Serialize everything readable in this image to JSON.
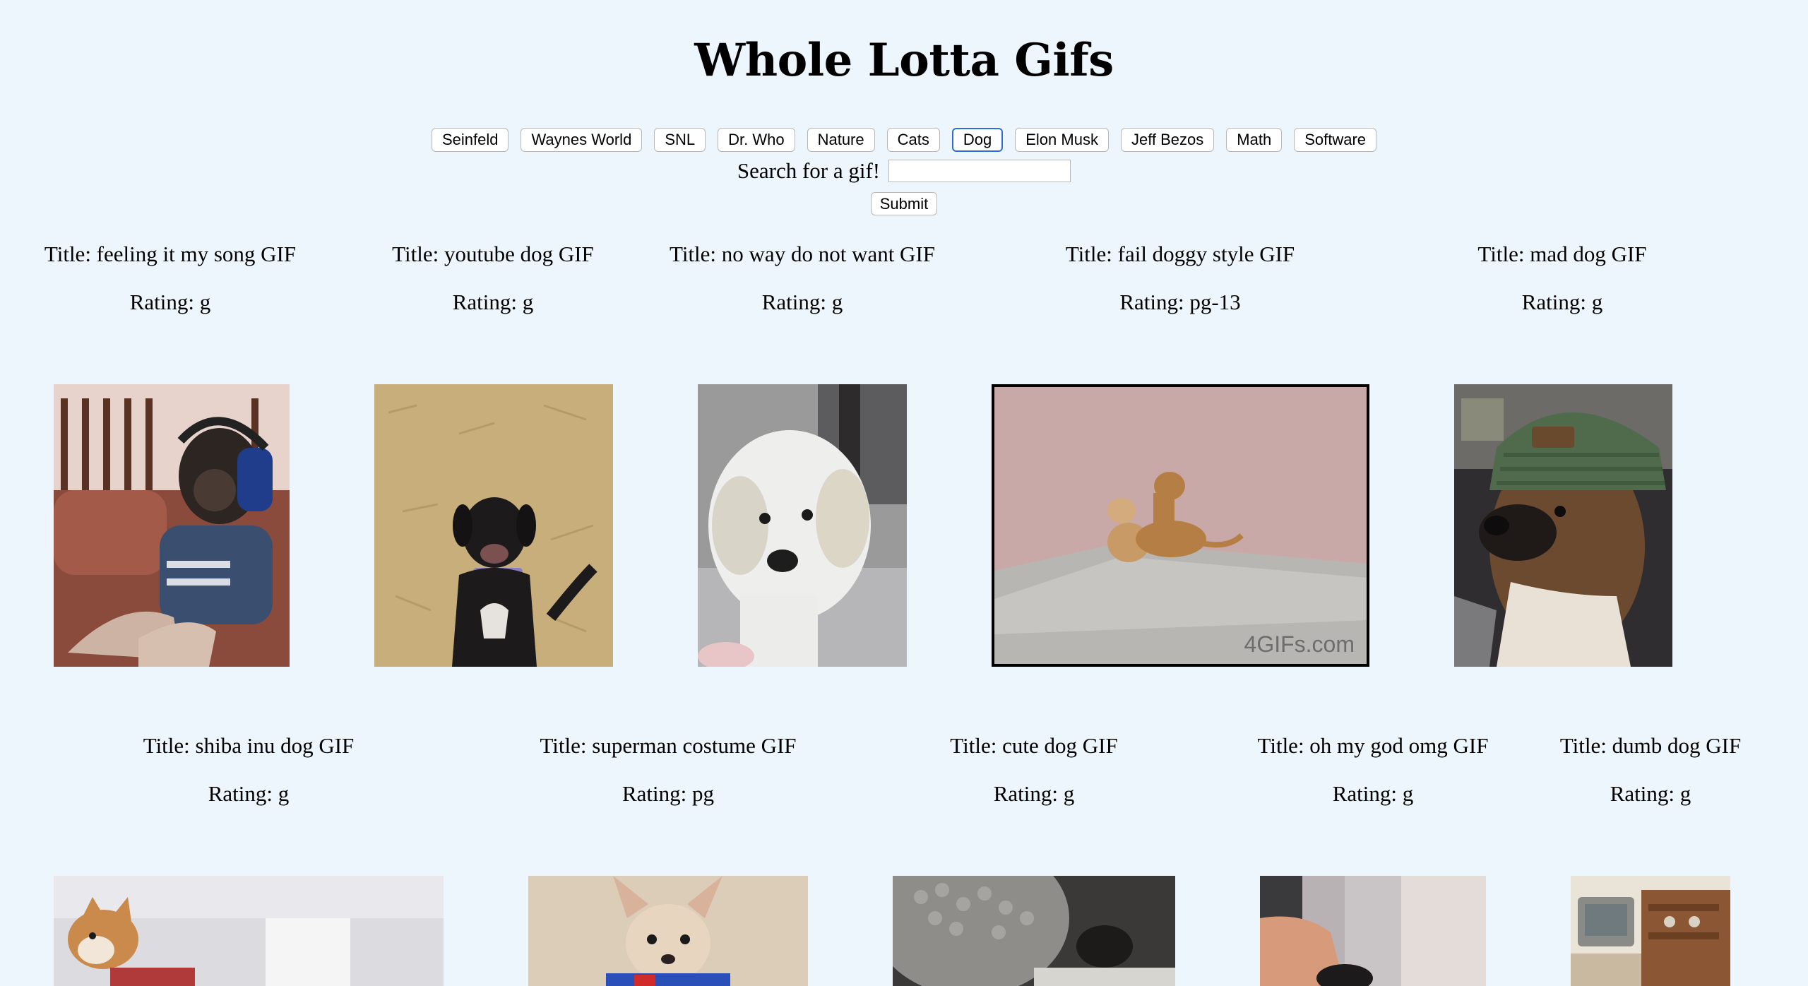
{
  "header": {
    "title": "Whole Lotta Gifs"
  },
  "topics": [
    {
      "label": "Seinfeld",
      "active": false
    },
    {
      "label": "Waynes World",
      "active": false
    },
    {
      "label": "SNL",
      "active": false
    },
    {
      "label": "Dr. Who",
      "active": false
    },
    {
      "label": "Nature",
      "active": false
    },
    {
      "label": "Cats",
      "active": false
    },
    {
      "label": "Dog",
      "active": true
    },
    {
      "label": "Elon Musk",
      "active": false
    },
    {
      "label": "Jeff Bezos",
      "active": false
    },
    {
      "label": "Math",
      "active": false
    },
    {
      "label": "Software",
      "active": false
    }
  ],
  "search": {
    "label": "Search for a gif!",
    "value": "",
    "submit_label": "Submit"
  },
  "gifs": [
    {
      "title": "Title: feeling it my song GIF",
      "rating": "Rating: g"
    },
    {
      "title": "Title: youtube dog GIF",
      "rating": "Rating: g"
    },
    {
      "title": "Title: no way do not want GIF",
      "rating": "Rating: g"
    },
    {
      "title": "Title: fail doggy style GIF",
      "rating": "Rating: pg-13",
      "watermark": "4GIFs.com"
    },
    {
      "title": "Title: mad dog GIF",
      "rating": "Rating: g"
    },
    {
      "title": "Title: shiba inu dog GIF",
      "rating": "Rating: g"
    },
    {
      "title": "Title: superman costume GIF",
      "rating": "Rating: pg"
    },
    {
      "title": "Title: cute dog GIF",
      "rating": "Rating: g"
    },
    {
      "title": "Title: oh my god omg GIF",
      "rating": "Rating: g"
    },
    {
      "title": "Title: dumb dog GIF",
      "rating": "Rating: g"
    }
  ],
  "colors": {
    "background": "#eef6fd",
    "active_button_border": "#2f6fcf"
  }
}
